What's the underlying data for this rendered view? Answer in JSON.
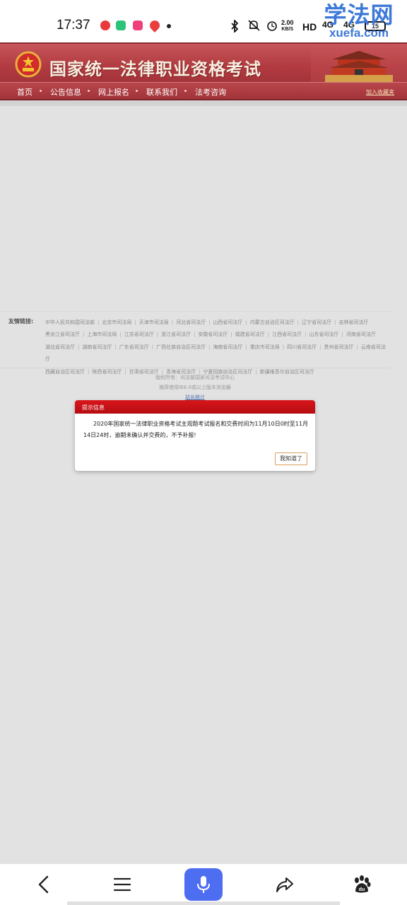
{
  "status_bar": {
    "time": "17:37",
    "net_speed_value": "2.00",
    "net_speed_unit": "KB/S",
    "hd_label": "HD",
    "signal_1": "4G",
    "signal_2": "4G",
    "battery": "15",
    "icons": [
      "netease-music-icon",
      "app-green-icon",
      "video-app-icon",
      "location-app-icon",
      "bluetooth-icon",
      "mute-icon",
      "alarm-icon"
    ]
  },
  "watermark": {
    "main": "学法网",
    "sub": "xuefa.com"
  },
  "site": {
    "title": "国家统一法律职业资格考试",
    "nav": [
      "首页",
      "公告信息",
      "网上报名",
      "联系我们",
      "法考咨询"
    ],
    "add_favorite": "加入收藏夹"
  },
  "links": {
    "title": "友情链接:",
    "items": [
      "中华人民共和国司法部",
      "北京市司法局",
      "天津市司法局",
      "河北省司法厅",
      "山西省司法厅",
      "内蒙古自治区司法厅",
      "辽宁省司法厅",
      "吉林省司法厅",
      "黑龙江省司法厅",
      "上海市司法局",
      "江苏省司法厅",
      "浙江省司法厅",
      "安徽省司法厅",
      "福建省司法厅",
      "江西省司法厅",
      "山东省司法厅",
      "河南省司法厅",
      "湖北省司法厅",
      "湖南省司法厅",
      "广东省司法厅",
      "广西壮族自治区司法厅",
      "海南省司法厅",
      "重庆市司法局",
      "四川省司法厅",
      "贵州省司法厅",
      "云南省司法厅",
      "西藏自治区司法厅",
      "陕西省司法厅",
      "甘肃省司法厅",
      "青海省司法厅",
      "宁夏回族自治区司法厅",
      "新疆维吾尔自治区司法厅"
    ]
  },
  "copyright": {
    "line1": "版权所有：司法部国家司法考试中心",
    "line2": "推荐使用IE8.0或以上版本浏览器",
    "stats_link": "站长统计"
  },
  "modal": {
    "title": "提示信息",
    "message": "2020年国家统一法律职业资格考试主观题考试报名和交费时间为11月10日0时至11月14日24时，逾期未确认并交费的，不予补报!",
    "ok_button": "我知道了"
  },
  "bottom_bar": {
    "icons": [
      "back-icon",
      "menu-icon",
      "microphone-icon",
      "share-icon",
      "baidu-icon"
    ],
    "accent": "#4e6ef2"
  },
  "colors": {
    "header_red": "#b13b40",
    "modal_header_red": "#d8161b",
    "watermark_blue": "#3d78d8"
  }
}
